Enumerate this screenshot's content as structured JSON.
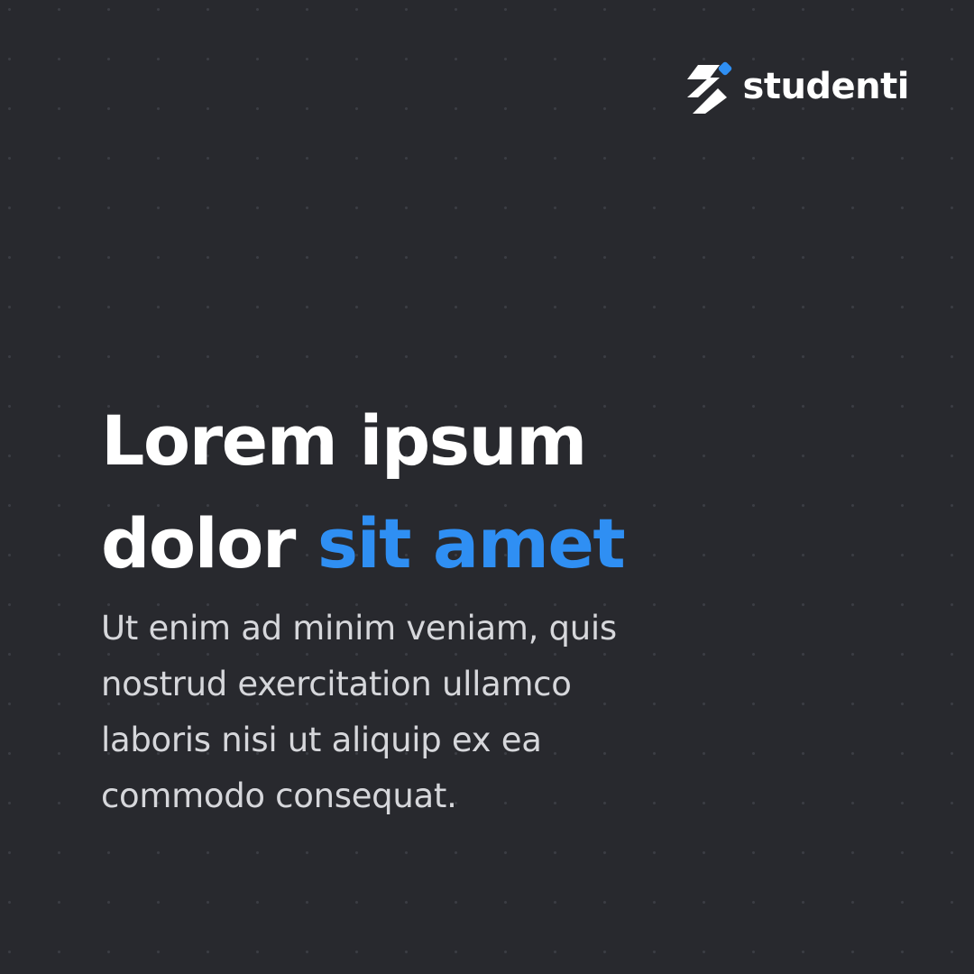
{
  "brand": {
    "name": "studenti",
    "mark_icon": "pencil-slash-logo-icon",
    "accent_color": "#2f8ff3"
  },
  "headline": {
    "line1": "Lorem ipsum",
    "line2_plain": "dolor ",
    "line2_accent": "sit amet",
    "color": "#ffffff",
    "accent_color": "#2f8ff3"
  },
  "body": {
    "line1": "Ut enim ad minim veniam, quis",
    "line2": "nostrud exercitation ullamco",
    "line3": "laboris nisi ut aliquip ex ea",
    "line4": "commodo consequat.",
    "color": "#d6d7db"
  },
  "background": {
    "color": "#28292e",
    "pattern": "dot-grid"
  }
}
